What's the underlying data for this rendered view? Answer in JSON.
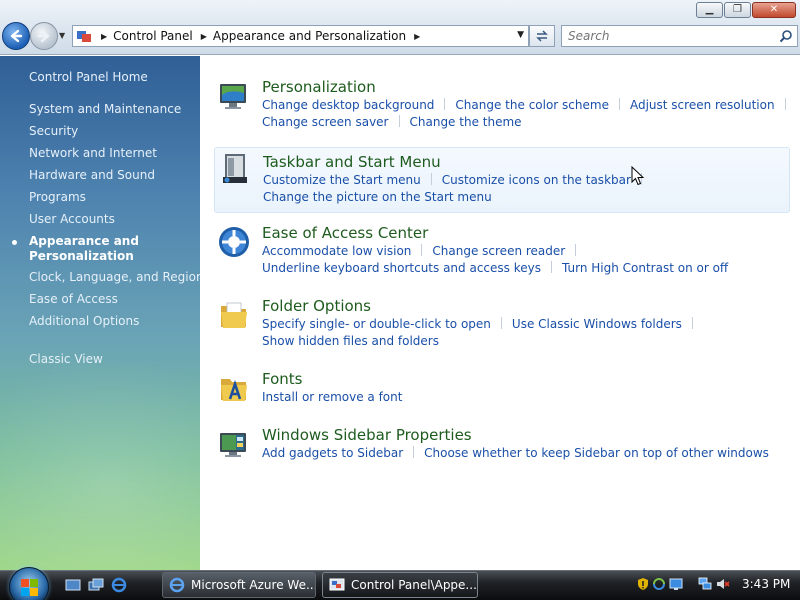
{
  "window": {
    "minimize_glyph": "▁",
    "maximize_glyph": "❐",
    "close_glyph": "✕"
  },
  "nav": {
    "back_icon": "arrow-left-icon",
    "forward_icon": "arrow-right-icon"
  },
  "address": {
    "segments": [
      "Control Panel",
      "Appearance and Personalization"
    ]
  },
  "search": {
    "placeholder": "Search"
  },
  "sidebar": {
    "items": [
      {
        "label": "Control Panel Home"
      },
      {
        "label": "System and Maintenance"
      },
      {
        "label": "Security"
      },
      {
        "label": "Network and Internet"
      },
      {
        "label": "Hardware and Sound"
      },
      {
        "label": "Programs"
      },
      {
        "label": "User Accounts"
      },
      {
        "label": "Appearance and Personalization",
        "active": true
      },
      {
        "label": "Clock, Language, and Region"
      },
      {
        "label": "Ease of Access"
      },
      {
        "label": "Additional Options"
      },
      {
        "label": "Classic View"
      }
    ]
  },
  "categories": [
    {
      "title": "Personalization",
      "icon": "monitor-icon",
      "rows": [
        [
          "Change desktop background",
          "Change the color scheme",
          "Adjust screen resolution"
        ],
        [
          "Change screen saver",
          "Change the theme"
        ]
      ]
    },
    {
      "title": "Taskbar and Start Menu",
      "icon": "taskbar-icon",
      "rows": [
        [
          "Customize the Start menu",
          "Customize icons on the taskbar"
        ],
        [
          "Change the picture on the Start menu"
        ]
      ]
    },
    {
      "title": "Ease of Access Center",
      "icon": "ease-of-access-icon",
      "rows": [
        [
          "Accommodate low vision",
          "Change screen reader"
        ],
        [
          "Underline keyboard shortcuts and access keys",
          "Turn High Contrast on or off"
        ]
      ]
    },
    {
      "title": "Folder Options",
      "icon": "folder-icon",
      "rows": [
        [
          "Specify single- or double-click to open",
          "Use Classic Windows folders"
        ],
        [
          "Show hidden files and folders"
        ]
      ]
    },
    {
      "title": "Fonts",
      "icon": "fonts-folder-icon",
      "rows": [
        [
          "Install or remove a font"
        ]
      ]
    },
    {
      "title": "Windows Sidebar Properties",
      "icon": "sidebar-icon",
      "rows": [
        [
          "Add gadgets to Sidebar",
          "Choose whether to keep Sidebar on top of other windows"
        ]
      ]
    }
  ],
  "taskbar": {
    "buttons": [
      {
        "label": "Microsoft Azure We...",
        "icon": "internet-explorer-icon",
        "active": false
      },
      {
        "label": "Control Panel\\Appe...",
        "icon": "control-panel-icon",
        "active": true
      }
    ],
    "clock": "3:43 PM"
  },
  "colors": {
    "link": "#1a4fa8",
    "category_title": "#1e5b1e",
    "sidebar_top": "#2f5f96",
    "sidebar_bottom": "#9fd78a"
  }
}
